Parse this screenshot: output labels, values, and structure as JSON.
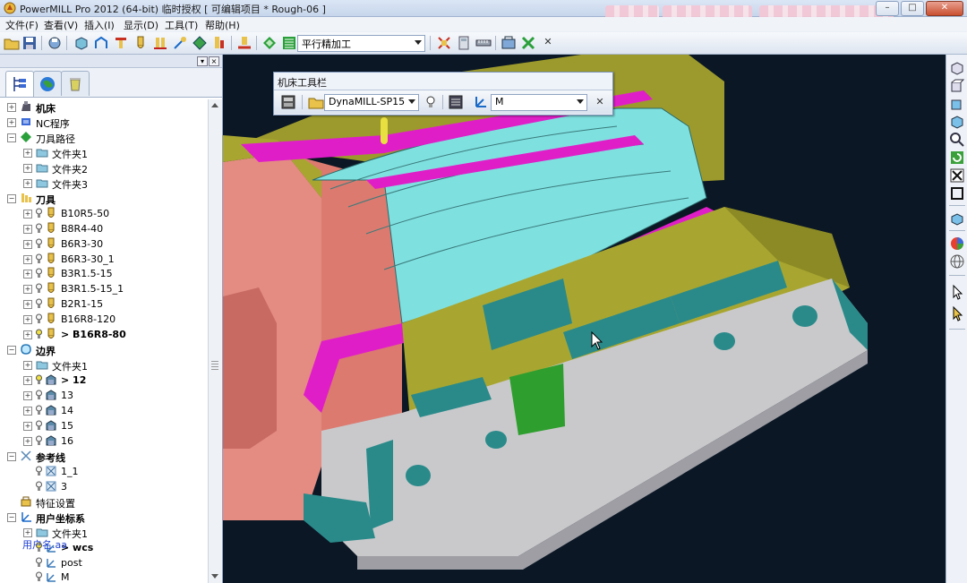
{
  "window": {
    "title": "PowerMILL Pro 2012 (64-bit) 临时授权    [ 可编辑项目 * Rough-06 ]",
    "minimize": "–",
    "maximize": "□",
    "close": "✕"
  },
  "menu": [
    "文件(F)",
    "查看(V)",
    "插入(I)",
    "显示(D)",
    "工具(T)",
    "帮助(H)"
  ],
  "toolbar": {
    "strategy_combo": "平行精加工"
  },
  "machine_toolbar": {
    "title": "机床工具栏",
    "machine_combo": "DynaMILL-SP15",
    "workplane_combo": "M"
  },
  "explorer": {
    "tabs": [
      "explorer-tab",
      "globe-tab",
      "recycle-tab"
    ],
    "tree": [
      {
        "label": "机床",
        "level": 0,
        "bold": true,
        "icon": "machine-icon",
        "expand": "+"
      },
      {
        "label": "NC程序",
        "level": 0,
        "bold": false,
        "icon": "nc-program-icon",
        "expand": "+"
      },
      {
        "label": "刀具路径",
        "level": 0,
        "bold": false,
        "icon": "toolpath-icon",
        "expand": "-"
      },
      {
        "label": "文件夹1",
        "level": 1,
        "bold": false,
        "icon": "folder-icon",
        "expand": "+"
      },
      {
        "label": "文件夹2",
        "level": 1,
        "bold": false,
        "icon": "folder-icon",
        "expand": "+"
      },
      {
        "label": "文件夹3",
        "level": 1,
        "bold": false,
        "icon": "folder-icon",
        "expand": "+"
      },
      {
        "label": "刀具",
        "level": 0,
        "bold": true,
        "icon": "tool-icon",
        "expand": "-"
      },
      {
        "label": "B10R5-50",
        "level": 1,
        "bold": false,
        "icon": "ball-tool-icon",
        "expand": "+",
        "bulb": true
      },
      {
        "label": "B8R4-40",
        "level": 1,
        "bold": false,
        "icon": "ball-tool-icon",
        "expand": "+",
        "bulb": true
      },
      {
        "label": "B6R3-30",
        "level": 1,
        "bold": false,
        "icon": "ball-tool-icon",
        "expand": "+",
        "bulb": true
      },
      {
        "label": "B6R3-30_1",
        "level": 1,
        "bold": false,
        "icon": "ball-tool-icon",
        "expand": "+",
        "bulb": true
      },
      {
        "label": "B3R1.5-15",
        "level": 1,
        "bold": false,
        "icon": "ball-tool-icon",
        "expand": "+",
        "bulb": true
      },
      {
        "label": "B3R1.5-15_1",
        "level": 1,
        "bold": false,
        "icon": "ball-tool-icon",
        "expand": "+",
        "bulb": true
      },
      {
        "label": "B2R1-15",
        "level": 1,
        "bold": false,
        "icon": "ball-tool-icon",
        "expand": "+",
        "bulb": true
      },
      {
        "label": "B16R8-120",
        "level": 1,
        "bold": false,
        "icon": "ball-tool-icon",
        "expand": "+",
        "bulb": true
      },
      {
        "label": "> B16R8-80",
        "level": 1,
        "bold": true,
        "icon": "ball-tool-icon",
        "expand": "+",
        "bulb": true,
        "active": true
      },
      {
        "label": "边界",
        "level": 0,
        "bold": true,
        "icon": "boundary-icon",
        "expand": "-"
      },
      {
        "label": "文件夹1",
        "level": 1,
        "bold": false,
        "icon": "folder-icon",
        "expand": "+"
      },
      {
        "label": "> 12",
        "level": 1,
        "bold": true,
        "icon": "boundary-item-icon",
        "expand": "+",
        "bulb": true,
        "active": true
      },
      {
        "label": "13",
        "level": 1,
        "bold": false,
        "icon": "boundary-item-icon",
        "expand": "+",
        "bulb": true
      },
      {
        "label": "14",
        "level": 1,
        "bold": false,
        "icon": "boundary-item-icon",
        "expand": "+",
        "bulb": true
      },
      {
        "label": "15",
        "level": 1,
        "bold": false,
        "icon": "boundary-item-icon",
        "expand": "+",
        "bulb": true
      },
      {
        "label": "16",
        "level": 1,
        "bold": false,
        "icon": "boundary-item-icon",
        "expand": "+",
        "bulb": true
      },
      {
        "label": "参考线",
        "level": 0,
        "bold": true,
        "icon": "pattern-icon",
        "expand": "-"
      },
      {
        "label": "1_1",
        "level": 1,
        "bold": false,
        "icon": "pattern-item-icon",
        "expand": "",
        "bulb": true
      },
      {
        "label": "3",
        "level": 1,
        "bold": false,
        "icon": "pattern-item-icon",
        "expand": "",
        "bulb": true
      },
      {
        "label": "特征设置",
        "level": 0,
        "bold": false,
        "icon": "feature-icon",
        "expand": ""
      },
      {
        "label": "用户坐标系",
        "level": 0,
        "bold": true,
        "icon": "workplane-icon",
        "expand": "-"
      },
      {
        "label": "文件夹1",
        "level": 1,
        "bold": false,
        "icon": "folder-icon",
        "expand": "+"
      },
      {
        "label": "> wcs",
        "level": 1,
        "bold": true,
        "icon": "workplane-item-icon",
        "expand": "",
        "bulb": true,
        "active": true
      },
      {
        "label": "post",
        "level": 1,
        "bold": false,
        "icon": "workplane-item-icon",
        "expand": "",
        "bulb": true
      },
      {
        "label": "M",
        "level": 1,
        "bold": false,
        "icon": "workplane-item-icon",
        "expand": "",
        "bulb": true
      }
    ],
    "overlay_username": "用户名.aa"
  },
  "colors": {
    "viewport_bg": "#0b1725",
    "olive": "#9c9a2c",
    "magenta": "#e01ec8",
    "cyan": "#7fe0e0",
    "salmon": "#e48c82",
    "grey": "#c9c9cb",
    "teal": "#2a8a8a"
  }
}
